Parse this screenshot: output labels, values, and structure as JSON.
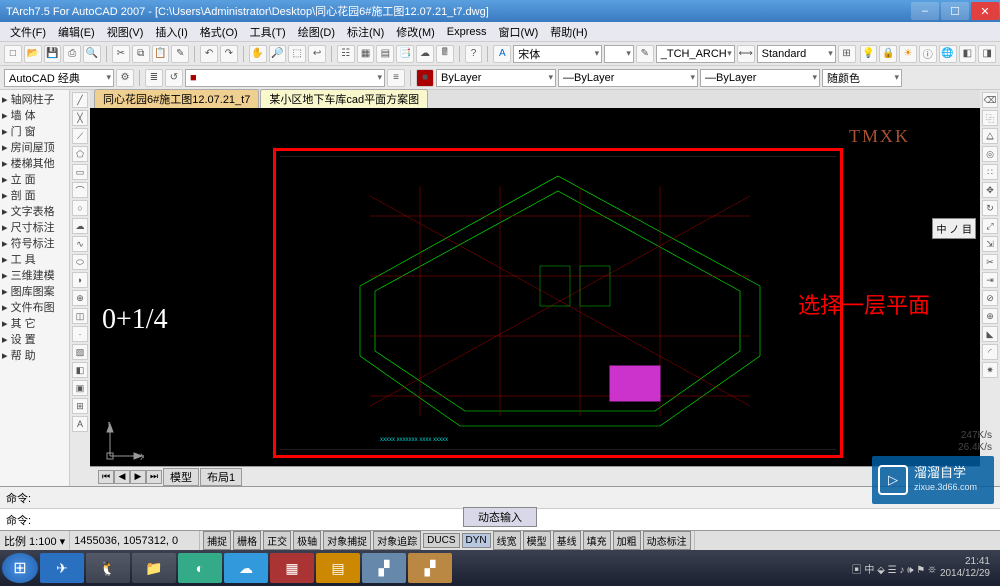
{
  "title": "TArch7.5 For AutoCAD 2007 - [C:\\Users\\Administrator\\Desktop\\同心花园6#施工图12.07.21_t7.dwg]",
  "menu": [
    "文件(F)",
    "编辑(E)",
    "视图(V)",
    "插入(I)",
    "格式(O)",
    "工具(T)",
    "绘图(D)",
    "标注(N)",
    "修改(M)",
    "Express",
    "窗口(W)",
    "帮助(H)"
  ],
  "row2": {
    "workspace": "AutoCAD 经典",
    "font": "宋体",
    "textstyle": "_TCH_ARCH",
    "dimstyle": "Standard"
  },
  "row3": {
    "color": "ByLayer",
    "linetype": "ByLayer",
    "lineweight": "ByLayer",
    "plotstyle": "随颜色"
  },
  "left_tree": [
    "▸ 轴网柱子",
    "▸ 墙    体",
    "▸ 门    窗",
    "▸ 房间屋顶",
    "▸ 楼梯其他",
    "▸ 立    面",
    "▸ 剖    面",
    "▸ 文字表格",
    "▸ 尺寸标注",
    "▸ 符号标注",
    "▸ 工    具",
    "▸ 三维建模",
    "▸ 图库图案",
    "▸ 文件布图",
    "▸ 其    它",
    "▸ 设    置",
    "▸ 帮    助"
  ],
  "canvas": {
    "tab1": "同心花园6#施工图12.07.21_t7",
    "tab2": "某小区地下车库cad平面方案图",
    "annotation": "选择一层平面",
    "brand": "TMXK",
    "fraction": "0+1/4",
    "axis_y": "Y",
    "axis_x": "X",
    "fusion": "中 ノ 目"
  },
  "bottom_tabs": {
    "model": "模型",
    "layout1": "布局1"
  },
  "cmd": {
    "prompt": "命令:",
    "dyninput": "动态输入"
  },
  "status": {
    "scale": "比例 1:100 ▾",
    "coords": "1455036, 1057312, 0",
    "toggles": [
      "捕捉",
      "栅格",
      "正交",
      "极轴",
      "对象捕捉",
      "对象追踪",
      "DUCS",
      "DYN",
      "线宽",
      "模型",
      "基线",
      "填充",
      "加粗",
      "动态标注"
    ]
  },
  "speed": {
    "down": "247K/s",
    "up": "26.4K/s"
  },
  "taskbar": {
    "tray_icons": "▣ 中 ⬙ ☰ ♪ 🕪 ⚑ ⛯",
    "time": "21:41",
    "date": "2014/12/29"
  },
  "watermark": {
    "name": "溜溜自学",
    "site": "zixue.3d66.com"
  }
}
